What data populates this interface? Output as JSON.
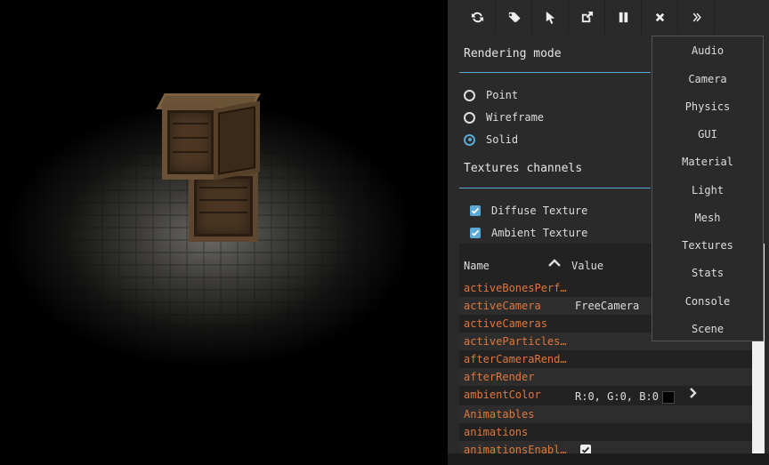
{
  "toolbar": {
    "icons": [
      "refresh-icon",
      "tags-icon",
      "pointer-icon",
      "external-link-icon",
      "pause-icon",
      "close-icon",
      "double-chevron-right-icon"
    ]
  },
  "rendering": {
    "title": "Rendering mode",
    "options": [
      "Point",
      "Wireframe",
      "Solid"
    ],
    "selected": "Solid"
  },
  "textures": {
    "title": "Textures channels",
    "options": [
      {
        "label": "Diffuse Texture",
        "checked": true
      },
      {
        "label": "Ambient Texture",
        "checked": true
      }
    ]
  },
  "table": {
    "col_name": "Name",
    "col_value": "Value",
    "rows": [
      {
        "name": "activeBonesPerf…",
        "value": ""
      },
      {
        "name": "activeCamera",
        "value": "FreeCamera"
      },
      {
        "name": "activeCameras",
        "value": ""
      },
      {
        "name": "activeParticles…",
        "value": ""
      },
      {
        "name": "afterCameraRend…",
        "value": ""
      },
      {
        "name": "afterRender",
        "value": ""
      },
      {
        "name": "ambientColor",
        "value": "R:0, G:0, B:0"
      },
      {
        "name": "Animatables",
        "value": ""
      },
      {
        "name": "animations",
        "value": ""
      },
      {
        "name": "animationsEnabl…",
        "value": ""
      }
    ]
  },
  "menu": {
    "items": [
      "Audio",
      "Camera",
      "Physics",
      "GUI",
      "Material",
      "Light",
      "Mesh",
      "Textures",
      "Stats",
      "Console",
      "Scene"
    ]
  },
  "colors": {
    "accent": "#5aa9d6",
    "property": "#e0773b",
    "panel_bg": "#2a2a2a"
  }
}
